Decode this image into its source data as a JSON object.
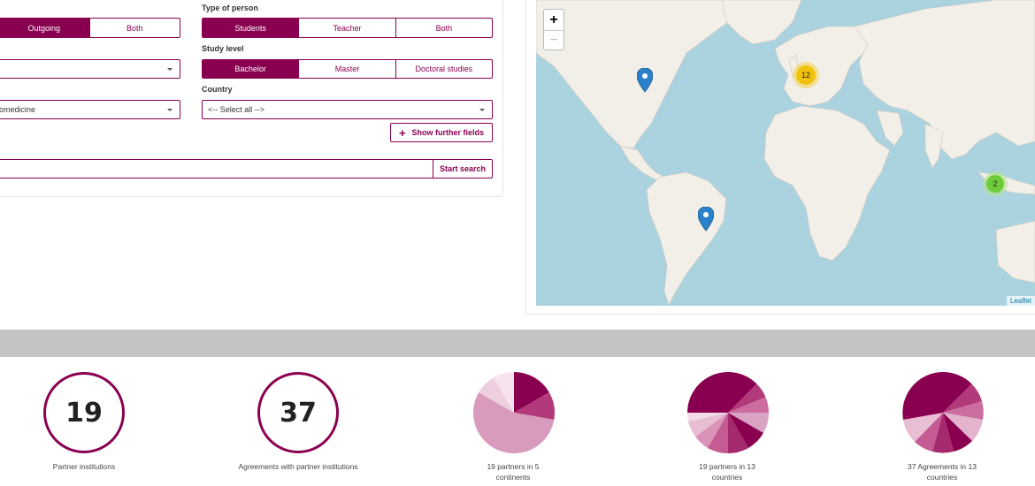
{
  "filters": {
    "direction": {
      "options": [
        "Outgoing",
        "Both"
      ],
      "active": "Outgoing"
    },
    "type_of_person": {
      "label": "Type of person",
      "options": [
        "Students",
        "Teacher",
        "Both"
      ],
      "active": "Students"
    },
    "study_level": {
      "label": "Study level",
      "options": [
        "Bachelor",
        "Master",
        "Doctoral studies"
      ],
      "active": "Bachelor"
    },
    "subject_select_value": "omedicine",
    "country": {
      "label": "Country",
      "value": "<-- Select all -->"
    },
    "show_further_fields": "Show further fields",
    "start_search": "Start search"
  },
  "map": {
    "zoom_in": "+",
    "zoom_out": "−",
    "cluster_europe": "12",
    "cluster_asia": "2",
    "attribution": "Leaflet"
  },
  "stats": [
    {
      "value": "19",
      "caption": "Partner institutions"
    },
    {
      "value": "37",
      "caption": "Agreements with partner institutions"
    },
    {
      "caption_line1": "19 partners in 5",
      "caption_line2": "continents"
    },
    {
      "caption_line1": "19 partners in 13",
      "caption_line2": "countries"
    },
    {
      "caption_line1": "37 Agreements in 13",
      "caption_line2": "countries"
    }
  ],
  "colors": {
    "accent": "#8a0050",
    "band": "#c4c4c4",
    "water": "#aad3df",
    "land": "#f2efe9"
  }
}
